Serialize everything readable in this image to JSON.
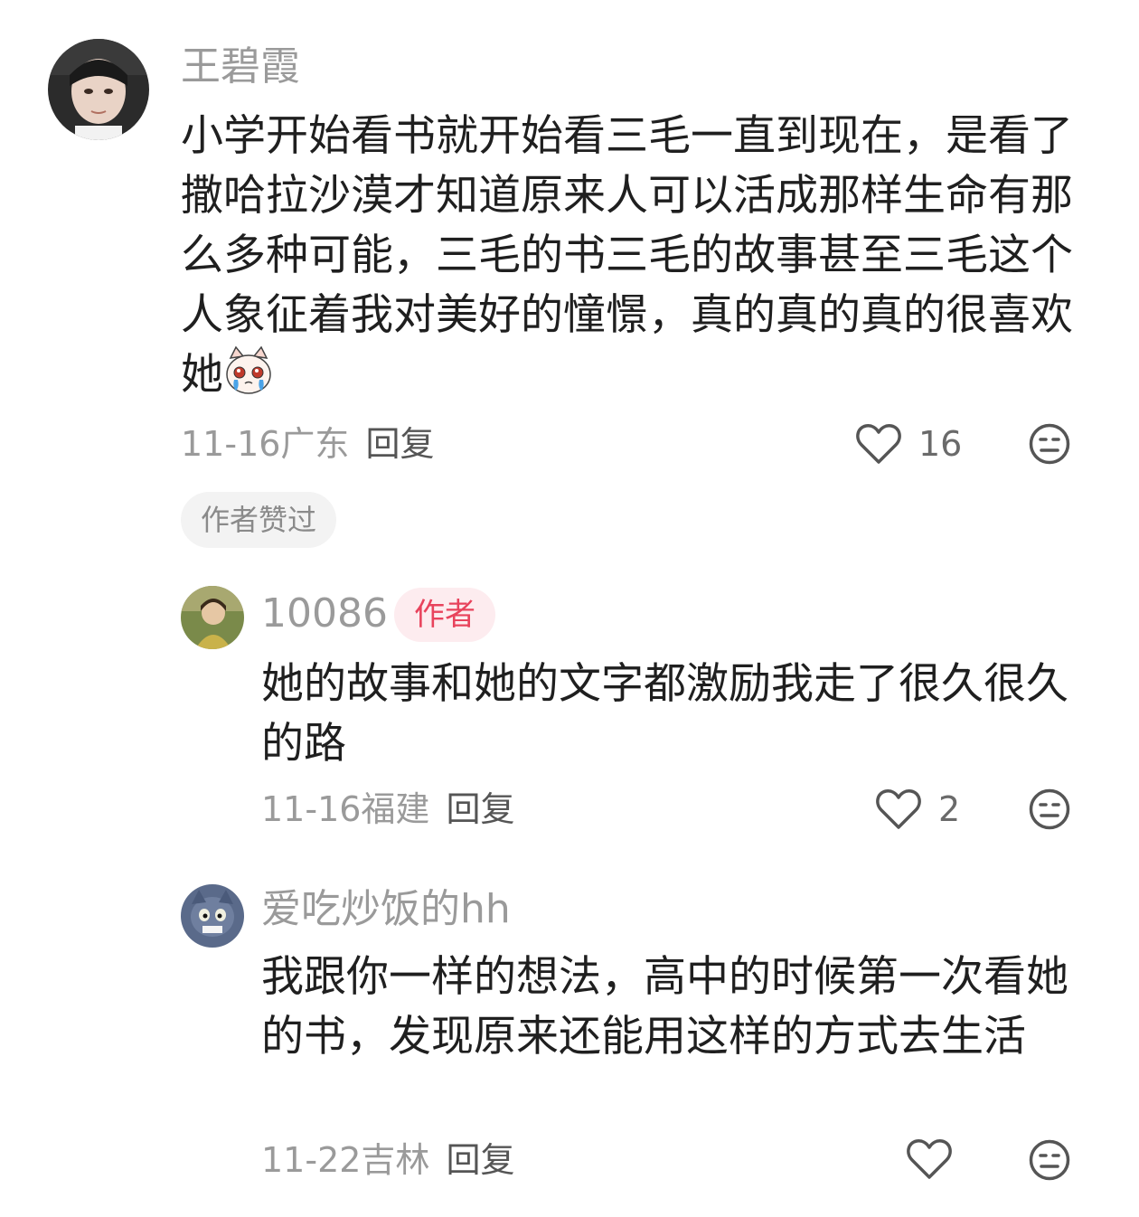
{
  "comments": [
    {
      "username": "王碧霞",
      "text": "小学开始看书就开始看三毛一直到现在，是看了撒哈拉沙漠才知道原来人可以活成那样生命有那么多种可能，三毛的书三毛的故事甚至三毛这个人象征着我对美好的憧憬，真的真的真的很喜欢她",
      "emoji": "crying-cat-emoji",
      "date": "11-16",
      "location": "广东",
      "reply_label": "回复",
      "likes": "16",
      "tag": "作者赞过"
    },
    {
      "username": "10086",
      "badge": "作者",
      "text": "她的故事和她的文字都激励我走了很久很久的路",
      "date": "11-16",
      "location": "福建",
      "reply_label": "回复",
      "likes": "2"
    },
    {
      "username": "爱吃炒饭的hh",
      "text": "我跟你一样的想法，高中的时候第一次看她的书，发现原来还能用这样的方式去生活",
      "date": "11-22",
      "location": "吉林",
      "reply_label": "回复",
      "likes": ""
    }
  ],
  "colors": {
    "username": "#9a9a9a",
    "body": "#1f1f1f",
    "meta": "#9a9a9a",
    "author_badge_bg": "#fdecef",
    "author_badge_text": "#e8435c",
    "tag_bg": "#f3f3f3"
  },
  "icons": [
    "heart-outline-icon",
    "meh-face-icon"
  ]
}
